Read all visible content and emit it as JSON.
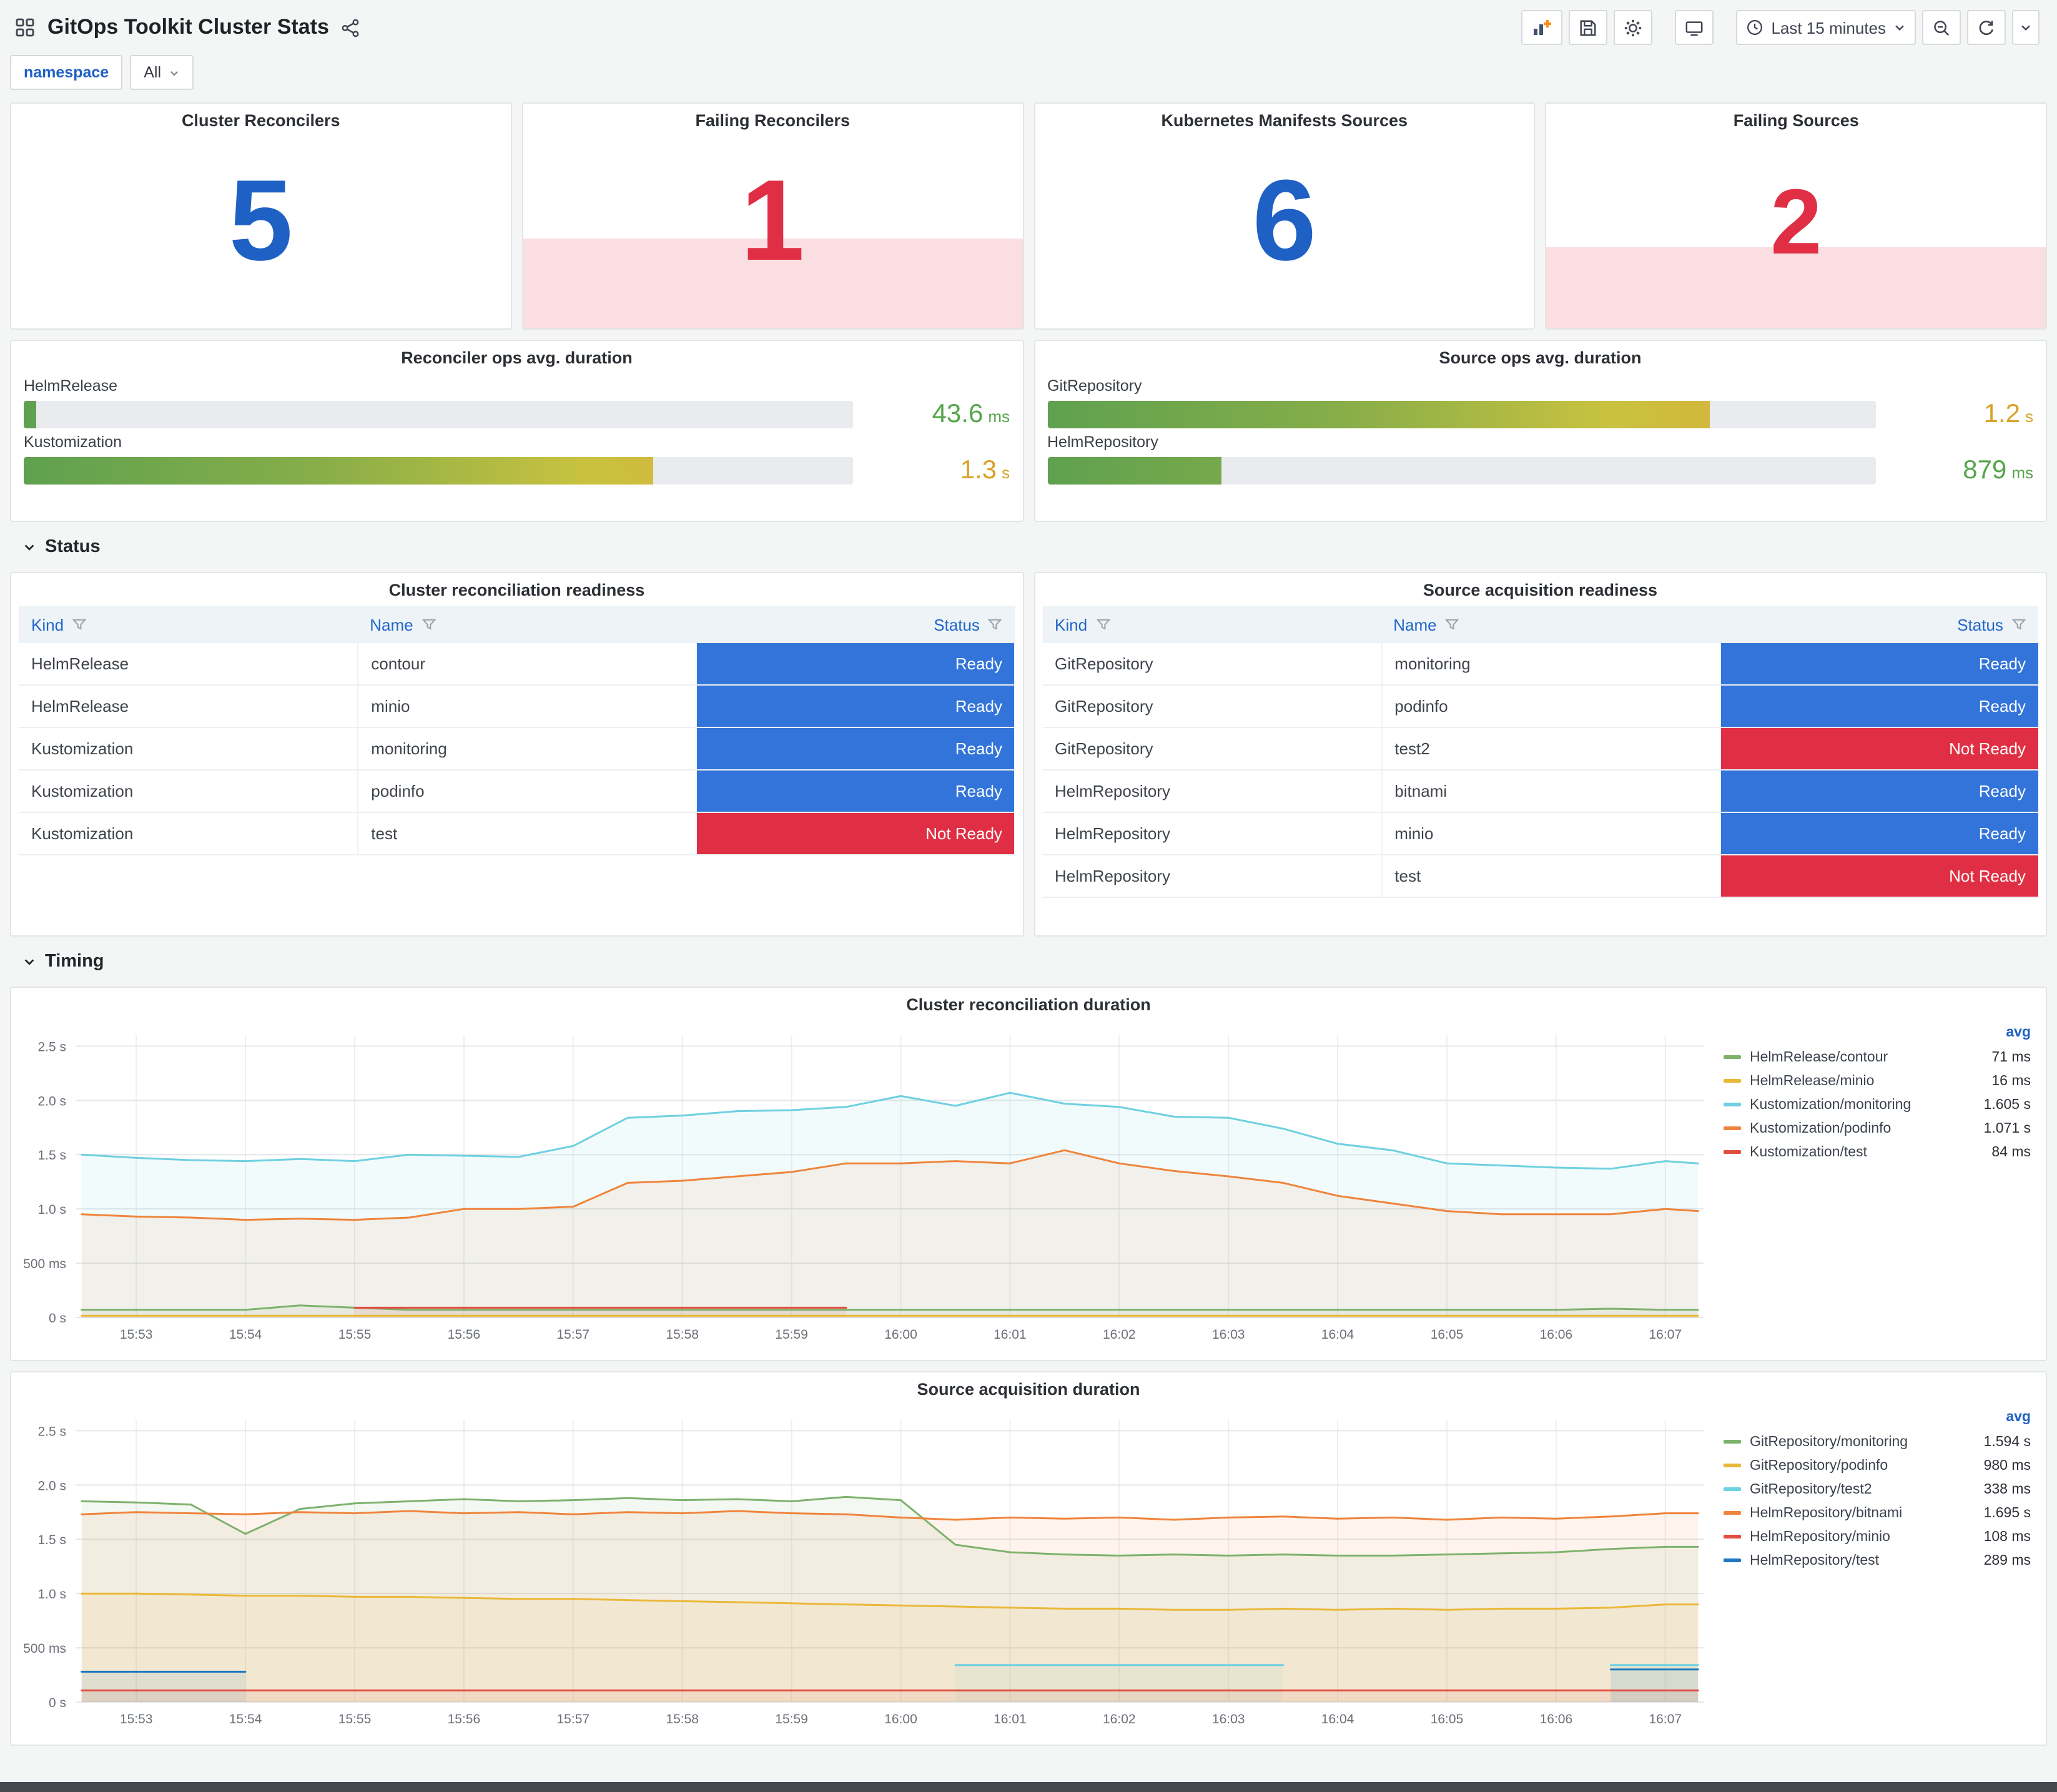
{
  "header": {
    "title": "GitOps Toolkit Cluster Stats"
  },
  "toolbar": {
    "time_range": "Last 15 minutes"
  },
  "icons": [
    "dashboard-grid-icon",
    "share-icon",
    "add-panel-icon",
    "save-icon",
    "gear-icon",
    "tv-mode-icon",
    "clock-icon",
    "chevron-down-icon",
    "zoom-out-icon",
    "refresh-icon",
    "filter-icon"
  ],
  "filters": {
    "namespace_label": "namespace",
    "namespace_value": "All"
  },
  "palette": {
    "blue": "#1F60C4",
    "red": "#E02F44",
    "threshold_bg": "rgba(224,47,68,0.16)",
    "ready": "#3274D9",
    "not_ready": "#E02F44"
  },
  "stats": [
    {
      "title": "Cluster Reconcilers",
      "value": "5",
      "color": "#1F60C4",
      "threshold": false
    },
    {
      "title": "Failing Reconcilers",
      "value": "1",
      "color": "#E02F44",
      "threshold": true
    },
    {
      "title": "Kubernetes Manifests Sources",
      "value": "6",
      "color": "#1F60C4",
      "threshold": false
    },
    {
      "title": "Failing Sources",
      "value": "2",
      "color": "#E02F44",
      "threshold": true
    }
  ],
  "gauges": [
    {
      "title": "Reconciler ops avg. duration",
      "rows": [
        {
          "label": "HelmRelease",
          "value": "43.6",
          "unit": "ms",
          "pct": 1.5,
          "value_color": "#56A64B"
        },
        {
          "label": "Kustomization",
          "value": "1.3",
          "unit": "s",
          "pct": 76,
          "value_color": "#D9A226"
        }
      ]
    },
    {
      "title": "Source ops avg. duration",
      "rows": [
        {
          "label": "GitRepository",
          "value": "1.2",
          "unit": "s",
          "pct": 80,
          "value_color": "#D9A226"
        },
        {
          "label": "HelmRepository",
          "value": "879",
          "unit": "ms",
          "pct": 21,
          "value_color": "#56A64B"
        }
      ]
    }
  ],
  "sections": {
    "status": "Status",
    "timing": "Timing"
  },
  "tables": [
    {
      "title": "Cluster reconciliation readiness",
      "columns": [
        "Kind",
        "Name",
        "Status"
      ],
      "rows": [
        {
          "kind": "HelmRelease",
          "name": "contour",
          "status": "Ready"
        },
        {
          "kind": "HelmRelease",
          "name": "minio",
          "status": "Ready"
        },
        {
          "kind": "Kustomization",
          "name": "monitoring",
          "status": "Ready"
        },
        {
          "kind": "Kustomization",
          "name": "podinfo",
          "status": "Ready"
        },
        {
          "kind": "Kustomization",
          "name": "test",
          "status": "Not Ready"
        }
      ]
    },
    {
      "title": "Source acquisition readiness",
      "columns": [
        "Kind",
        "Name",
        "Status"
      ],
      "rows": [
        {
          "kind": "GitRepository",
          "name": "monitoring",
          "status": "Ready"
        },
        {
          "kind": "GitRepository",
          "name": "podinfo",
          "status": "Ready"
        },
        {
          "kind": "GitRepository",
          "name": "test2",
          "status": "Not Ready"
        },
        {
          "kind": "HelmRepository",
          "name": "bitnami",
          "status": "Ready"
        },
        {
          "kind": "HelmRepository",
          "name": "minio",
          "status": "Ready"
        },
        {
          "kind": "HelmRepository",
          "name": "test",
          "status": "Not Ready"
        }
      ]
    }
  ],
  "chart_data": [
    {
      "type": "line",
      "title": "Cluster reconciliation duration",
      "xlabel": "",
      "ylabel": "",
      "ylim": [
        0,
        2.6
      ],
      "xrange": [
        -0.55,
        14.35
      ],
      "grid": true,
      "legend_position": "right",
      "legend_header": "avg",
      "yticks": [
        {
          "v": 0,
          "label": "0 s"
        },
        {
          "v": 0.5,
          "label": "500 ms"
        },
        {
          "v": 1,
          "label": "1.0 s"
        },
        {
          "v": 1.5,
          "label": "1.5 s"
        },
        {
          "v": 2,
          "label": "2.0 s"
        },
        {
          "v": 2.5,
          "label": "2.5 s"
        }
      ],
      "xticks": [
        {
          "v": 0,
          "label": "15:53"
        },
        {
          "v": 1,
          "label": "15:54"
        },
        {
          "v": 2,
          "label": "15:55"
        },
        {
          "v": 3,
          "label": "15:56"
        },
        {
          "v": 4,
          "label": "15:57"
        },
        {
          "v": 5,
          "label": "15:58"
        },
        {
          "v": 6,
          "label": "15:59"
        },
        {
          "v": 7,
          "label": "16:00"
        },
        {
          "v": 8,
          "label": "16:01"
        },
        {
          "v": 9,
          "label": "16:02"
        },
        {
          "v": 10,
          "label": "16:03"
        },
        {
          "v": 11,
          "label": "16:04"
        },
        {
          "v": 12,
          "label": "16:05"
        },
        {
          "v": 13,
          "label": "16:06"
        },
        {
          "v": 14,
          "label": "16:07"
        }
      ],
      "x": [
        -0.5,
        0,
        0.5,
        1,
        1.5,
        2,
        2.5,
        3,
        3.5,
        4,
        4.5,
        5,
        5.5,
        6,
        6.5,
        7,
        7.5,
        8,
        8.5,
        9,
        9.5,
        10,
        10.5,
        11,
        11.5,
        12,
        12.5,
        13,
        13.5,
        14,
        14.3
      ],
      "series": [
        {
          "name": "HelmRelease/contour",
          "color": "#7EB26D",
          "avg": "71 ms",
          "values": [
            0.07,
            0.07,
            0.07,
            0.07,
            0.11,
            0.09,
            0.07,
            0.07,
            0.07,
            0.07,
            0.07,
            0.07,
            0.07,
            0.07,
            0.07,
            0.07,
            0.07,
            0.07,
            0.07,
            0.07,
            0.07,
            0.07,
            0.07,
            0.07,
            0.07,
            0.07,
            0.07,
            0.07,
            0.08,
            0.07,
            0.07
          ]
        },
        {
          "name": "HelmRelease/minio",
          "color": "#EAB839",
          "avg": "16 ms",
          "values": [
            0.016,
            0.016,
            0.016,
            0.016,
            0.016,
            0.016,
            0.016,
            0.016,
            0.016,
            0.016,
            0.016,
            0.016,
            0.016,
            0.016,
            0.016,
            0.016,
            0.016,
            0.016,
            0.016,
            0.016,
            0.016,
            0.016,
            0.016,
            0.016,
            0.016,
            0.016,
            0.016,
            0.016,
            0.016,
            0.016,
            0.016
          ]
        },
        {
          "name": "Kustomization/monitoring",
          "color": "#6ED0E0",
          "avg": "1.605 s",
          "values": [
            1.5,
            1.47,
            1.45,
            1.44,
            1.46,
            1.44,
            1.5,
            1.49,
            1.48,
            1.58,
            1.84,
            1.86,
            1.9,
            1.91,
            1.94,
            2.04,
            1.95,
            2.07,
            1.97,
            1.94,
            1.85,
            1.84,
            1.74,
            1.6,
            1.54,
            1.42,
            1.4,
            1.38,
            1.37,
            1.44,
            1.42
          ]
        },
        {
          "name": "Kustomization/podinfo",
          "color": "#EF843C",
          "avg": "1.071 s",
          "values": [
            0.95,
            0.93,
            0.92,
            0.9,
            0.91,
            0.9,
            0.92,
            1.0,
            1.0,
            1.02,
            1.24,
            1.26,
            1.3,
            1.34,
            1.42,
            1.42,
            1.44,
            1.42,
            1.54,
            1.42,
            1.35,
            1.3,
            1.24,
            1.12,
            1.05,
            0.98,
            0.95,
            0.95,
            0.95,
            1.0,
            0.98
          ]
        },
        {
          "name": "Kustomization/test",
          "color": "#E24D42",
          "avg": "84 ms",
          "values": [
            null,
            null,
            null,
            null,
            null,
            0.09,
            0.09,
            0.09,
            0.09,
            0.09,
            0.09,
            0.09,
            0.09,
            0.09,
            0.09,
            null,
            null,
            null,
            null,
            null,
            null,
            null,
            null,
            null,
            null,
            null,
            null,
            null,
            null,
            null,
            null
          ]
        }
      ]
    },
    {
      "type": "line",
      "title": "Source acquisition duration",
      "xlabel": "",
      "ylabel": "",
      "ylim": [
        0,
        2.6
      ],
      "xrange": [
        -0.55,
        14.35
      ],
      "grid": true,
      "legend_position": "right",
      "legend_header": "avg",
      "yticks": [
        {
          "v": 0,
          "label": "0 s"
        },
        {
          "v": 0.5,
          "label": "500 ms"
        },
        {
          "v": 1,
          "label": "1.0 s"
        },
        {
          "v": 1.5,
          "label": "1.5 s"
        },
        {
          "v": 2,
          "label": "2.0 s"
        },
        {
          "v": 2.5,
          "label": "2.5 s"
        }
      ],
      "xticks": [
        {
          "v": 0,
          "label": "15:53"
        },
        {
          "v": 1,
          "label": "15:54"
        },
        {
          "v": 2,
          "label": "15:55"
        },
        {
          "v": 3,
          "label": "15:56"
        },
        {
          "v": 4,
          "label": "15:57"
        },
        {
          "v": 5,
          "label": "15:58"
        },
        {
          "v": 6,
          "label": "15:59"
        },
        {
          "v": 7,
          "label": "16:00"
        },
        {
          "v": 8,
          "label": "16:01"
        },
        {
          "v": 9,
          "label": "16:02"
        },
        {
          "v": 10,
          "label": "16:03"
        },
        {
          "v": 11,
          "label": "16:04"
        },
        {
          "v": 12,
          "label": "16:05"
        },
        {
          "v": 13,
          "label": "16:06"
        },
        {
          "v": 14,
          "label": "16:07"
        }
      ],
      "x": [
        -0.5,
        0,
        0.5,
        1,
        1.5,
        2,
        2.5,
        3,
        3.5,
        4,
        4.5,
        5,
        5.5,
        6,
        6.5,
        7,
        7.5,
        8,
        8.5,
        9,
        9.5,
        10,
        10.5,
        11,
        11.5,
        12,
        12.5,
        13,
        13.5,
        14,
        14.3
      ],
      "series": [
        {
          "name": "GitRepository/monitoring",
          "color": "#7EB26D",
          "avg": "1.594 s",
          "values": [
            1.85,
            1.84,
            1.82,
            1.55,
            1.78,
            1.83,
            1.85,
            1.87,
            1.85,
            1.86,
            1.88,
            1.86,
            1.87,
            1.85,
            1.89,
            1.86,
            1.45,
            1.38,
            1.36,
            1.35,
            1.36,
            1.35,
            1.36,
            1.35,
            1.35,
            1.36,
            1.37,
            1.38,
            1.41,
            1.43,
            1.43
          ]
        },
        {
          "name": "GitRepository/podinfo",
          "color": "#EAB839",
          "avg": "980 ms",
          "values": [
            1.0,
            1.0,
            0.99,
            0.98,
            0.98,
            0.97,
            0.97,
            0.96,
            0.95,
            0.95,
            0.94,
            0.93,
            0.92,
            0.91,
            0.9,
            0.89,
            0.88,
            0.87,
            0.86,
            0.86,
            0.85,
            0.85,
            0.86,
            0.85,
            0.86,
            0.85,
            0.86,
            0.86,
            0.87,
            0.9,
            0.9
          ]
        },
        {
          "name": "GitRepository/test2",
          "color": "#6ED0E0",
          "avg": "338 ms",
          "values": [
            null,
            null,
            null,
            null,
            null,
            null,
            null,
            null,
            null,
            null,
            null,
            null,
            null,
            null,
            null,
            null,
            0.34,
            0.34,
            0.34,
            0.34,
            0.34,
            0.34,
            0.34,
            null,
            null,
            null,
            null,
            null,
            0.34,
            0.34,
            0.34
          ]
        },
        {
          "name": "HelmRepository/bitnami",
          "color": "#EF843C",
          "avg": "1.695 s",
          "values": [
            1.73,
            1.75,
            1.74,
            1.73,
            1.75,
            1.74,
            1.76,
            1.74,
            1.75,
            1.73,
            1.75,
            1.74,
            1.76,
            1.74,
            1.73,
            1.7,
            1.68,
            1.7,
            1.69,
            1.7,
            1.68,
            1.7,
            1.71,
            1.69,
            1.7,
            1.68,
            1.7,
            1.69,
            1.71,
            1.74,
            1.74
          ]
        },
        {
          "name": "HelmRepository/minio",
          "color": "#E24D42",
          "avg": "108 ms",
          "values": [
            0.108,
            0.108,
            0.108,
            0.108,
            0.108,
            0.108,
            0.108,
            0.108,
            0.108,
            0.108,
            0.108,
            0.108,
            0.108,
            0.108,
            0.108,
            0.108,
            0.108,
            0.108,
            0.108,
            0.108,
            0.108,
            0.108,
            0.108,
            0.108,
            0.108,
            0.108,
            0.108,
            0.108,
            0.108,
            0.108,
            0.108
          ]
        },
        {
          "name": "HelmRepository/test",
          "color": "#1F78C1",
          "avg": "289 ms",
          "values": [
            0.28,
            0.28,
            0.28,
            0.28,
            null,
            null,
            null,
            null,
            null,
            null,
            null,
            null,
            null,
            null,
            null,
            null,
            null,
            null,
            null,
            null,
            null,
            null,
            null,
            null,
            null,
            null,
            null,
            null,
            0.3,
            0.3,
            0.3
          ]
        }
      ]
    }
  ]
}
